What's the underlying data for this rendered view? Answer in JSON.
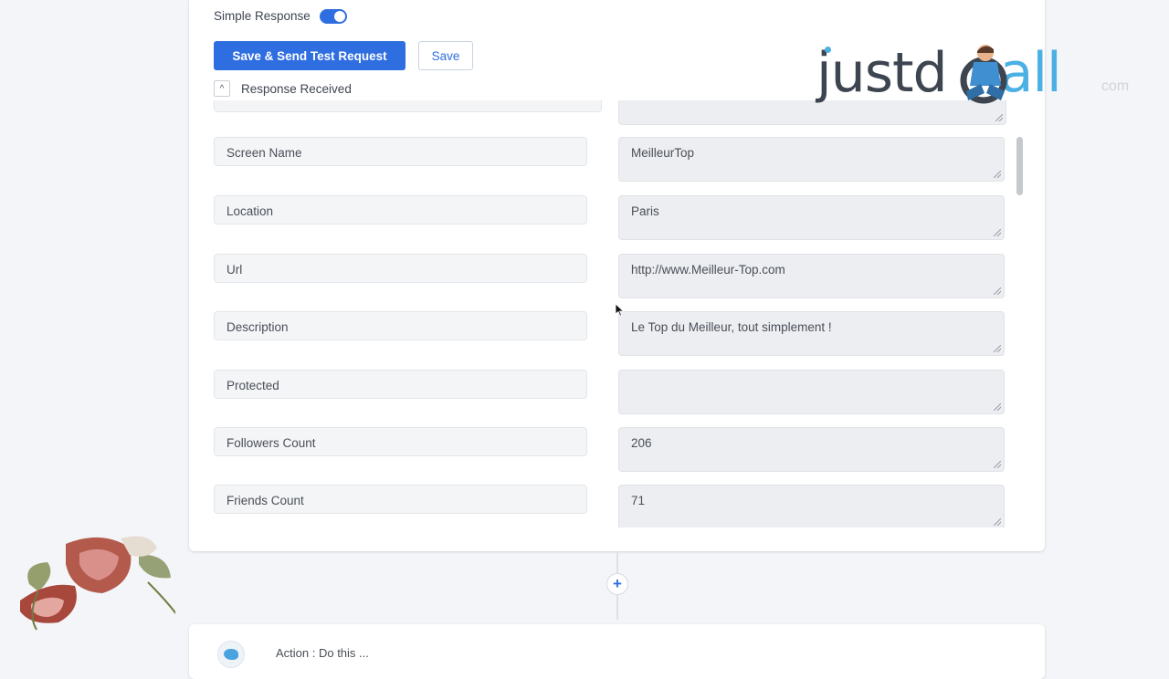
{
  "simple_response": {
    "label": "Simple Response",
    "enabled": true
  },
  "buttons": {
    "save_and_send": "Save & Send Test Request",
    "save": "Save"
  },
  "response_section": {
    "label": "Response Received",
    "collapse_icon": "^"
  },
  "fields": [
    {
      "key": "Screen Name",
      "value": "MeilleurTop"
    },
    {
      "key": "Location",
      "value": "Paris"
    },
    {
      "key": "Url",
      "value": "http://www.Meilleur-Top.com"
    },
    {
      "key": "Description",
      "value": "Le Top du Meilleur, tout simplement !"
    },
    {
      "key": "Protected",
      "value": ""
    },
    {
      "key": "Followers Count",
      "value": "206"
    },
    {
      "key": "Friends Count",
      "value": "71"
    }
  ],
  "add_step": {
    "icon": "+"
  },
  "action": {
    "label": "Action : Do this ..."
  },
  "watermark": {
    "text_start": "justd",
    "text_end": "all",
    "faint_text": "com"
  },
  "colors": {
    "accent": "#2f6ee0",
    "watermark_blue": "#4bb0e3",
    "card_bg": "#ffffff",
    "page_bg": "#f3f5f8"
  }
}
